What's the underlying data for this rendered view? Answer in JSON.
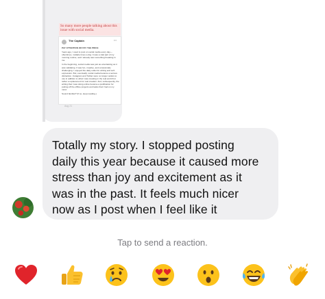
{
  "shared_post": {
    "quote": "So many more people talking about this issue with social media.",
    "tweet_author": "The Captain",
    "tweet_heading": "PAY ATTENTION OR PAY THE PRICE",
    "tweet_paragraphs": [
      "Years ago, I used to post on social media every day—oftentimes, multiple times a day. It was a vital part of my morning routine, and I already saw something breaking in me.",
      "In the beginning, social media was just as entertaining as it was validating. It was fun, creative, and occasionally challenging. I enjoyed the daily outlet for writing and self-expression. But, eventually, social media became a serious distraction. Instagram and Twitter were no longer outlets to use in addition to what I was creating in the real world but rather a replacement for real creation. And, subsequently, the writing that I was doing online became a justification for putting off the offline projects and tasks that I had on my mind.",
      "Sound familiar? (If so, keep reading.)"
    ],
    "tweet_date": "Aug 21"
  },
  "message": {
    "lines": [
      "Totally my story. I stopped posting",
      "daily this year because it caused more",
      "stress than joy and excitement as it",
      "was in the past. It feels much nicer",
      "now as I post when I feel like it"
    ]
  },
  "sender": {
    "avatar_icon": "profile-photo-flowers"
  },
  "reaction_hint": "Tap to send a reaction.",
  "reactions": [
    {
      "name": "red-heart",
      "glyph": "❤️"
    },
    {
      "name": "thumbs-up",
      "glyph": "👍"
    },
    {
      "name": "crying-face",
      "glyph": "😢"
    },
    {
      "name": "heart-eyes",
      "glyph": "😍"
    },
    {
      "name": "surprised-face",
      "glyph": "😮"
    },
    {
      "name": "tears-of-joy",
      "glyph": "😂"
    },
    {
      "name": "clapping-hands",
      "glyph": "👏"
    }
  ]
}
